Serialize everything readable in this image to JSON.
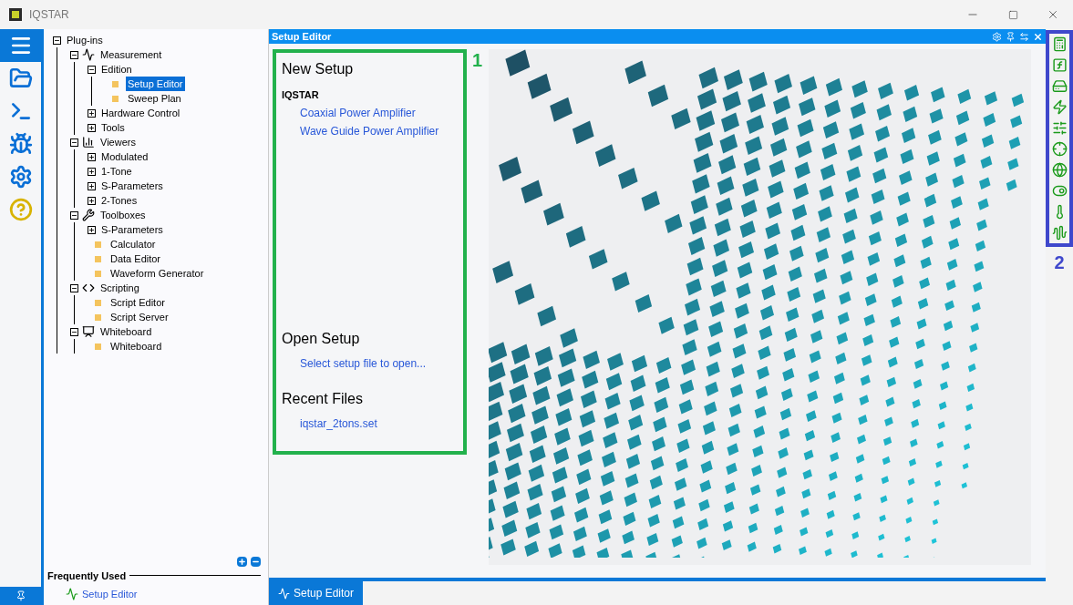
{
  "window": {
    "title": "IQSTAR"
  },
  "rail": [
    {
      "kind": "menu",
      "selected": true
    },
    {
      "kind": "folder",
      "selected": false
    },
    {
      "kind": "terminal",
      "selected": false
    },
    {
      "kind": "bug",
      "selected": false
    },
    {
      "kind": "settings",
      "selected": false
    },
    {
      "kind": "help",
      "selected": false
    }
  ],
  "tree": [
    {
      "label": "Plug-ins",
      "kind": "group",
      "expanded": true,
      "selected": false,
      "children": [
        {
          "label": "Measurement",
          "kind": "group",
          "expanded": true,
          "selected": false,
          "children": [
            {
              "label": "Edition",
              "kind": "group",
              "expanded": true,
              "selected": false,
              "children": [
                {
                  "label": "Setup Editor",
                  "kind": "leaf",
                  "selected": true
                },
                {
                  "label": "Sweep Plan",
                  "kind": "leaf",
                  "selected": false
                }
              ]
            },
            {
              "label": "Hardware Control",
              "kind": "group",
              "expanded": false,
              "selected": false
            },
            {
              "label": "Tools",
              "kind": "group",
              "expanded": false,
              "selected": false
            }
          ]
        },
        {
          "label": "Viewers",
          "kind": "group",
          "expanded": true,
          "selected": false,
          "children": [
            {
              "label": "Modulated",
              "kind": "group",
              "expanded": false,
              "selected": false
            },
            {
              "label": "1-Tone",
              "kind": "group",
              "expanded": false,
              "selected": false
            },
            {
              "label": "S-Parameters",
              "kind": "group",
              "expanded": false,
              "selected": false
            },
            {
              "label": "2-Tones",
              "kind": "group",
              "expanded": false,
              "selected": false
            }
          ]
        },
        {
          "label": "Toolboxes",
          "kind": "group",
          "expanded": true,
          "selected": false,
          "children": [
            {
              "label": "S-Parameters",
              "kind": "group",
              "expanded": false,
              "selected": false
            },
            {
              "label": "Calculator",
              "kind": "leaf",
              "selected": false
            },
            {
              "label": "Data Editor",
              "kind": "leaf",
              "selected": false
            },
            {
              "label": "Waveform Generator",
              "kind": "leaf",
              "selected": false
            }
          ]
        },
        {
          "label": "Scripting",
          "kind": "group",
          "expanded": true,
          "selected": false,
          "children": [
            {
              "label": "Script Editor",
              "kind": "leaf",
              "selected": false
            },
            {
              "label": "Script Server",
              "kind": "leaf",
              "selected": false
            }
          ]
        },
        {
          "label": "Whiteboard",
          "kind": "group",
          "expanded": true,
          "selected": false,
          "children": [
            {
              "label": "Whiteboard",
              "kind": "leaf",
              "selected": false
            }
          ]
        }
      ]
    }
  ],
  "frequently_used": {
    "title": "Frequently Used",
    "items": [
      "Setup Editor"
    ]
  },
  "panel": {
    "title": "Setup Editor",
    "new_setup": {
      "title": "New Setup",
      "vendor": "IQSTAR",
      "links": [
        "Coaxial Power Amplifier",
        "Wave Guide Power Amplifier"
      ]
    },
    "open_setup": {
      "title": "Open Setup",
      "link": "Select setup file to open..."
    },
    "recent_files": {
      "title": "Recent Files",
      "links": [
        "iqstar_2tons.set"
      ]
    }
  },
  "annotations": [
    {
      "label": "1",
      "color": "#22b14c"
    },
    {
      "label": "2",
      "color": "#3f48cc"
    }
  ],
  "tabs": [
    {
      "label": "Setup Editor",
      "selected": true
    }
  ]
}
